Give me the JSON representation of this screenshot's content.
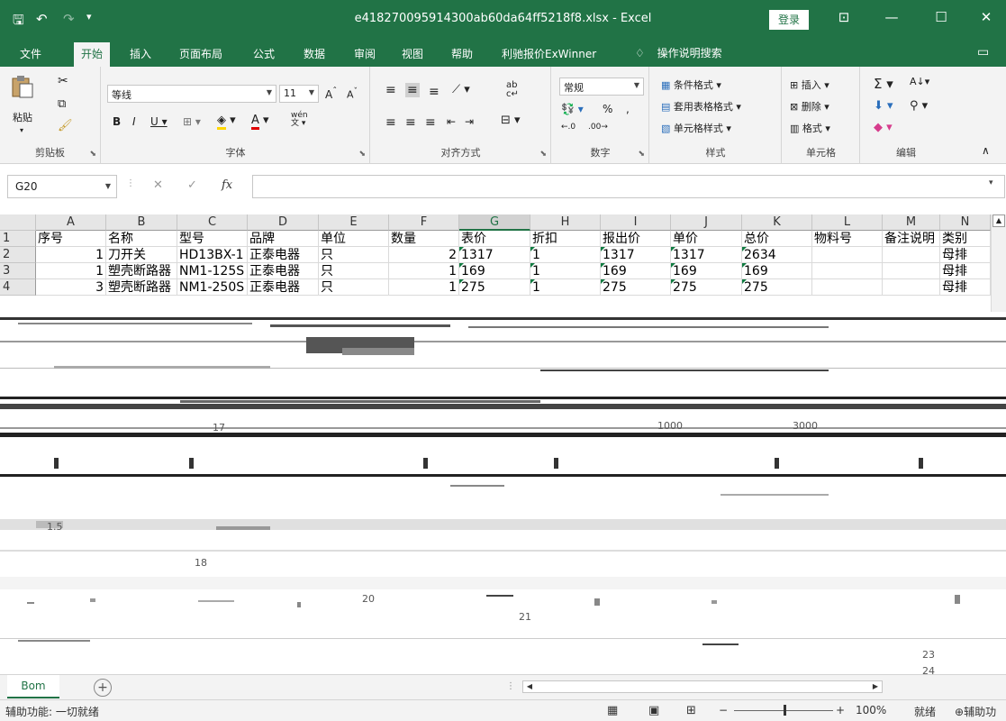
{
  "title": "e418270095914300ab60da64ff5218f8.xlsx  -  Excel",
  "login_label": "登录",
  "window_buttons": {
    "ribbon_display": "⊡",
    "minimize": "—",
    "maximize": "☐",
    "close": "✕"
  },
  "tabs": [
    "文件",
    "开始",
    "插入",
    "页面布局",
    "公式",
    "数据",
    "审阅",
    "视图",
    "帮助",
    "利驰报价ExWinner"
  ],
  "active_tab": "开始",
  "search_placeholder": "操作说明搜索",
  "ribbon": {
    "clipboard": {
      "paste": "粘贴",
      "label": "剪贴板"
    },
    "font": {
      "name": "等线",
      "size": "11",
      "phonetic": "wén",
      "label": "字体"
    },
    "alignment": {
      "label": "对齐方式"
    },
    "number": {
      "format": "常规",
      "label": "数字"
    },
    "styles": {
      "conditional": "条件格式",
      "table": "套用表格格式",
      "cell_styles": "单元格样式",
      "label": "样式"
    },
    "cells": {
      "insert": "插入",
      "delete": "删除",
      "format": "格式",
      "label": "单元格"
    },
    "editing": {
      "label": "编辑"
    }
  },
  "name_box": "G20",
  "fx_label": "fx",
  "columns": [
    "A",
    "B",
    "C",
    "D",
    "E",
    "F",
    "G",
    "H",
    "I",
    "J",
    "K",
    "L",
    "M",
    "N"
  ],
  "selected_column": "G",
  "rows": [
    {
      "num": "1",
      "cells": [
        "序号",
        "名称",
        "型号",
        "品牌",
        "单位",
        "数量",
        "表价",
        "折扣",
        "报出价",
        "单价",
        "总价",
        "物料号",
        "备注说明",
        "类别"
      ]
    },
    {
      "num": "2",
      "cells": [
        "1",
        "刀开关",
        "HD13BX-1",
        "正泰电器",
        "只",
        "2",
        "1317",
        "1",
        "1317",
        "1317",
        "2634",
        "",
        "",
        "母排"
      ]
    },
    {
      "num": "3",
      "cells": [
        "1",
        "塑壳断路器",
        "NM1-125S",
        "正泰电器",
        "只",
        "1",
        "169",
        "1",
        "169",
        "169",
        "169",
        "",
        "",
        "母排"
      ]
    },
    {
      "num": "4",
      "cells": [
        "3",
        "塑壳断路器",
        "NM1-250S",
        "正泰电器",
        "只",
        "1",
        "275",
        "1",
        "275",
        "275",
        "275",
        "",
        "",
        "母排"
      ]
    }
  ],
  "garbled_fragments": [
    "18",
    "20",
    "21",
    "23",
    "24",
    "1.5",
    "17",
    "1000",
    "3000"
  ],
  "sheet_tab": "Bom",
  "status": {
    "ready": "就绪",
    "accessibility": "辅助功能: 一切就绪",
    "accessibility_right": "辅助功",
    "zoom": "100%"
  }
}
